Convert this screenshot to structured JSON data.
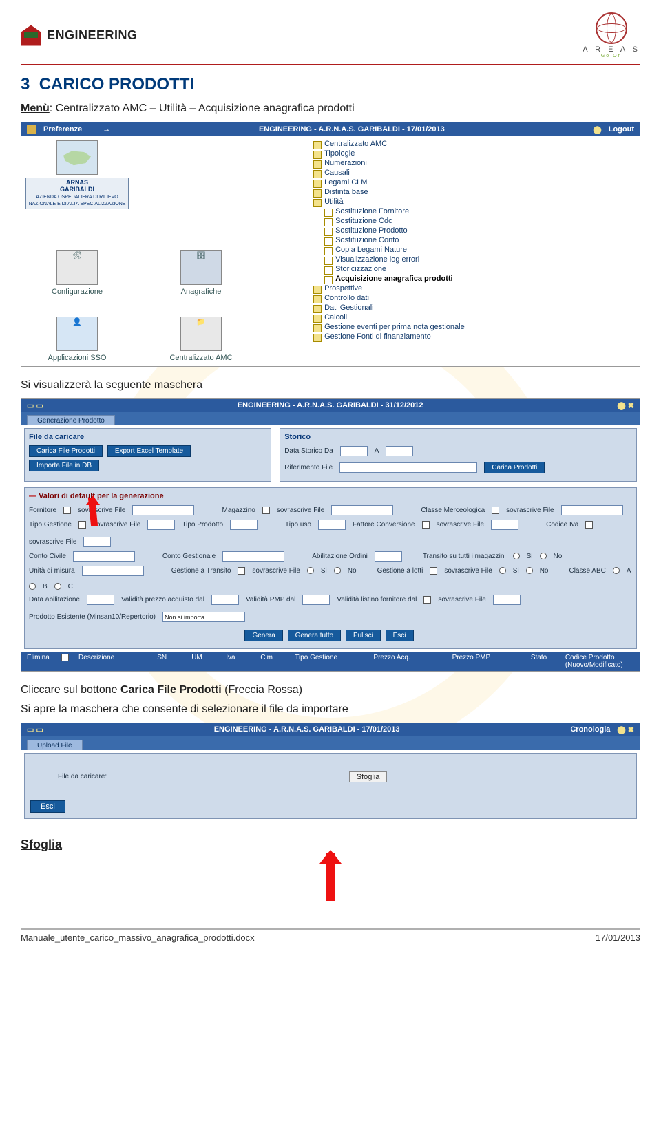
{
  "header": {
    "left_brand": "ENGINEERING",
    "right_brand": "A R E A S",
    "right_sub": "Go On"
  },
  "title_num": "3",
  "title_text": "CARICO PRODOTTI",
  "menu_label": "Menù",
  "menu_path": ": Centralizzato AMC – Utilità – Acquisizione anagrafica prodotti",
  "shot1": {
    "bar_left": "Preferenze",
    "bar_center": "ENGINEERING - A.R.N.A.S. GARIBALDI - 17/01/2013",
    "bar_right": "Logout",
    "caption1_title": "ARNAS",
    "caption1_sub": "GARIBALDI",
    "caption1_line": "AZIENDA OSPEDALIERA DI RILIEVO NAZIONALE E DI ALTA SPECIALIZZAZIONE",
    "tile2": "Configurazione",
    "tile3": "Anagrafiche",
    "tile4": "Applicazioni SSO",
    "tile5": "Centralizzato AMC",
    "tree": [
      "Centralizzato AMC",
      "Tipologie",
      "Numerazioni",
      "Causali",
      "Legami CLM",
      "Distinta base",
      "Utilità",
      "Sostituzione Fornitore",
      "Sostituzione Cdc",
      "Sostituzione Prodotto",
      "Sostituzione Conto",
      "Copia Legami Nature",
      "Visualizzazione log errori",
      "Storicizzazione",
      "Acquisizione anagrafica prodotti",
      "Prospettive",
      "Controllo dati",
      "Dati Gestionali",
      "Calcoli",
      "Gestione eventi per prima nota gestionale",
      "Gestione Fonti di finanziamento"
    ]
  },
  "text_between": "Si visualizzerà la seguente maschera",
  "shot2": {
    "bar_center": "ENGINEERING - A.R.N.A.S. GARIBALDI - 31/12/2012",
    "tab": "Generazione Prodotto",
    "p1_title": "File da caricare",
    "btn_carica_file": "Carica File Prodotti",
    "btn_export": "Export Excel Template",
    "btn_importa": "Importa File in DB",
    "p1b_title": "Storico",
    "lbl_data_storico": "Data Storico Da",
    "val_a": "A",
    "lbl_rif_file": "Riferimento File",
    "btn_carica_prod": "Carica Prodotti",
    "p2_title": "Valori di default per la generazione",
    "labels": {
      "fornitore": "Fornitore",
      "sovr": "sovrascrive File",
      "magazzino": "Magazzino",
      "classe_merc": "Classe Merceologica",
      "tipo_gestione": "Tipo Gestione",
      "tipo_prodotto": "Tipo Prodotto",
      "tipo_uso": "Tipo uso",
      "fattore_conv": "Fattore Conversione",
      "codice_iva": "Codice Iva",
      "conto_civile": "Conto Civile",
      "conto_gest": "Conto Gestionale",
      "abilit_ordini": "Abilitazione Ordini",
      "transito": "Transito su tutti i magazzini",
      "si": "Si",
      "no": "No",
      "um": "Unità di misura",
      "gest_trans": "Gestione a Transito",
      "gest_lotti": "Gestione a lotti",
      "classe_abc": "Classe ABC",
      "a": "A",
      "b": "B",
      "c": "C",
      "data_abil": "Data abilitazione",
      "validita_prezzo": "Validità prezzo acquisto dal",
      "validita_pmp": "Validità PMP dal",
      "validita_listino": "Validità listino fornitore dal",
      "prod_esist": "Prodotto Esistente (Minsan10/Repertorio)",
      "non_importa": "Non si importa"
    },
    "actions": {
      "genera": "Genera",
      "genera_tutto": "Genera tutto",
      "pulisci": "Pulisci",
      "esci": "Esci"
    },
    "cols": {
      "elimina": "Elimina",
      "descrizione": "Descrizione",
      "sn": "SN",
      "um": "UM",
      "iva": "Iva",
      "clm": "Clm",
      "tipo_gest": "Tipo Gestione",
      "prezzo_acq": "Prezzo Acq.",
      "prezzo_pmp": "Prezzo PMP",
      "stato": "Stato",
      "cod_prod": "Codice Prodotto (Nuovo/Modificato)"
    }
  },
  "text_click_line": "Cliccare sul bottone ",
  "text_click_btn": "Carica File Prodotti",
  "text_click_suffix": " (Freccia Rossa)",
  "text_mask_line": "Si apre la maschera che consente di selezionare il file da importare",
  "shot3": {
    "bar_center": "ENGINEERING - A.R.N.A.S. GARIBALDI - 17/01/2013",
    "cronologia": "Cronologia",
    "tab": "Upload File",
    "lbl_file": "File da caricare:",
    "btn_sfoglia": "Sfoglia",
    "btn_esci": "Esci"
  },
  "sfoglia_heading": "Sfoglia",
  "footer_left": "Manuale_utente_carico_massivo_anagrafica_prodotti.docx",
  "footer_right": "17/01/2013"
}
